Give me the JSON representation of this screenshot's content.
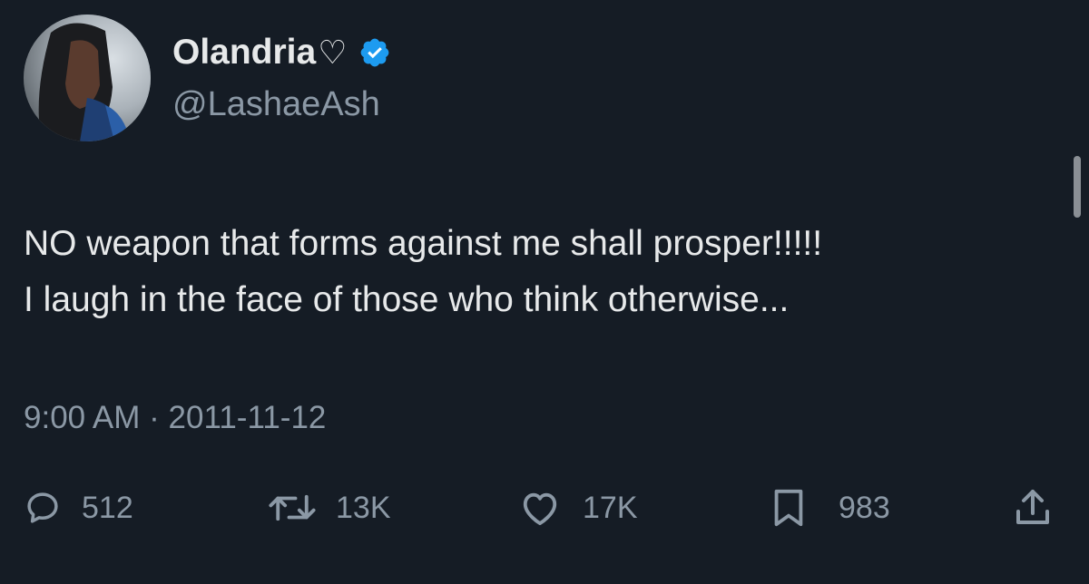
{
  "author": {
    "display_name": "Olandria",
    "name_emoji": "♡",
    "handle": "@LashaeAsh",
    "verified": true
  },
  "tweet": {
    "text": "NO weapon that forms against me shall prosper!!!!!\nI laugh in the face of those who think otherwise...",
    "time": "9:00 AM",
    "separator": "·",
    "date": "2011-11-12"
  },
  "actions": {
    "replies": "512",
    "retweets": "13K",
    "likes": "17K",
    "bookmarks": "983"
  },
  "icons": {
    "reply": "reply-icon",
    "retweet": "retweet-icon",
    "like": "heart-icon",
    "bookmark": "bookmark-icon",
    "share": "share-icon",
    "verified": "verified-badge-icon"
  },
  "colors": {
    "background": "#151c25",
    "text": "#e7e9ea",
    "secondary": "#8b98a5",
    "verified": "#1d9bf0"
  }
}
